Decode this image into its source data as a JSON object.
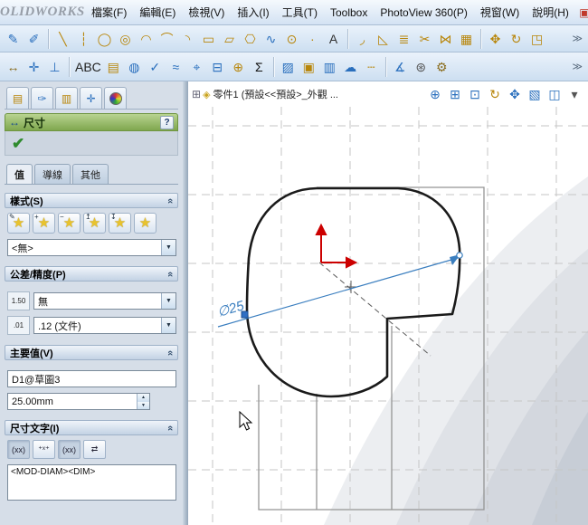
{
  "colors": {
    "accent_blue": "#2a6fbd",
    "toolbar_gold": "#b8860b",
    "panel_header_green": "#7fa74e",
    "dimension_blue": "#3a7ebf",
    "origin_red": "#cc0000",
    "selected_handle_blue": "#2f6fc4"
  },
  "titlebar": {
    "logo_text": "OLIDWORKS",
    "menus": [
      "檔案(F)",
      "編輯(E)",
      "檢視(V)",
      "插入(I)",
      "工具(T)",
      "Toolbox",
      "PhotoView 360(P)",
      "視窗(W)",
      "說明(H)"
    ],
    "resources_icon": "▣"
  },
  "toolbar1": {
    "overflow": "≫",
    "g1": [
      {
        "name": "sketch-icon",
        "glyph": "✎",
        "color": "#2a6fbd"
      },
      {
        "name": "3d-sketch-icon",
        "glyph": "✐",
        "color": "#2a6fbd"
      }
    ],
    "g2": [
      {
        "name": "line-tool-icon",
        "glyph": "╲",
        "color": "#b8860b"
      },
      {
        "name": "centerline-tool-icon",
        "glyph": "┆",
        "color": "#b8860b"
      },
      {
        "name": "circle-tool-icon",
        "glyph": "◯",
        "color": "#b8860b"
      },
      {
        "name": "perimeter-circle-tool-icon",
        "glyph": "◎",
        "color": "#b8860b"
      },
      {
        "name": "centerpoint-arc-tool-icon",
        "glyph": "◠",
        "color": "#b8860b"
      },
      {
        "name": "tangent-arc-tool-icon",
        "glyph": "⌒",
        "color": "#b8860b"
      },
      {
        "name": "three-point-arc-tool-icon",
        "glyph": "◝",
        "color": "#b8860b"
      },
      {
        "name": "rectangle-tool-icon",
        "glyph": "▭",
        "color": "#b8860b"
      },
      {
        "name": "parallelogram-tool-icon",
        "glyph": "▱",
        "color": "#b8860b"
      },
      {
        "name": "polygon-tool-icon",
        "glyph": "⎔",
        "color": "#b8860b"
      },
      {
        "name": "spline-tool-icon",
        "glyph": "∿",
        "color": "#2a6fbd"
      },
      {
        "name": "ellipse-tool-icon",
        "glyph": "⊙",
        "color": "#b8860b"
      },
      {
        "name": "point-tool-icon",
        "glyph": "∙",
        "color": "#b8860b"
      },
      {
        "name": "sketch-text-tool-icon",
        "glyph": "A",
        "color": "#333333"
      }
    ],
    "g3": [
      {
        "name": "sketch-fillet-tool-icon",
        "glyph": "◞",
        "color": "#b8860b"
      },
      {
        "name": "sketch-chamfer-tool-icon",
        "glyph": "◺",
        "color": "#b8860b"
      },
      {
        "name": "offset-entities-tool-icon",
        "glyph": "≣",
        "color": "#b8860b"
      },
      {
        "name": "trim-entities-tool-icon",
        "glyph": "✂",
        "color": "#b8860b"
      },
      {
        "name": "mirror-entities-tool-icon",
        "glyph": "⋈",
        "color": "#b8860b"
      },
      {
        "name": "sketch-pattern-tool-icon",
        "glyph": "▦",
        "color": "#b8860b"
      }
    ],
    "g4": [
      {
        "name": "move-entities-tool-icon",
        "glyph": "✥",
        "color": "#b8860b"
      },
      {
        "name": "rotate-entities-tool-icon",
        "glyph": "↻",
        "color": "#b8860b"
      },
      {
        "name": "scale-entities-tool-icon",
        "glyph": "◳",
        "color": "#b8860b"
      }
    ]
  },
  "toolbar2": {
    "overflow": "≫",
    "g1": [
      {
        "name": "smart-dimension-icon",
        "glyph": "↔",
        "color": "#8a6d1f"
      },
      {
        "name": "model-items-icon",
        "glyph": "✛",
        "color": "#2a6fbd"
      },
      {
        "name": "add-relation-icon",
        "glyph": "⊥",
        "color": "#2a6fbd"
      }
    ],
    "g2": [
      {
        "name": "spell-checker-icon",
        "glyph": "ABC",
        "color": "#222222"
      },
      {
        "name": "note-icon",
        "glyph": "▤",
        "color": "#b8860b"
      },
      {
        "name": "balloon-icon",
        "glyph": "◍",
        "color": "#2a6fbd"
      },
      {
        "name": "surface-finish-icon",
        "glyph": "✓",
        "color": "#2a6fbd"
      },
      {
        "name": "weld-symbol-icon",
        "glyph": "≈",
        "color": "#2a6fbd"
      },
      {
        "name": "geometric-tolerance-icon",
        "glyph": "⌖",
        "color": "#2a6fbd"
      },
      {
        "name": "datum-feature-icon",
        "glyph": "⊟",
        "color": "#2a6fbd"
      },
      {
        "name": "center-mark-icon",
        "glyph": "⊕",
        "color": "#b8860b"
      },
      {
        "name": "equations-icon",
        "glyph": "Σ",
        "color": "#111111"
      }
    ],
    "g3": [
      {
        "name": "area-hatch-icon",
        "glyph": "▨",
        "color": "#2a6fbd"
      },
      {
        "name": "blocks-icon",
        "glyph": "▣",
        "color": "#b8860b"
      },
      {
        "name": "tables-icon",
        "glyph": "▥",
        "color": "#2a6fbd"
      },
      {
        "name": "revision-cloud-icon",
        "glyph": "☁",
        "color": "#2a6fbd"
      },
      {
        "name": "centerline-annotation-icon",
        "glyph": "┄",
        "color": "#b8860b"
      }
    ],
    "g4": [
      {
        "name": "measure-icon",
        "glyph": "∡",
        "color": "#2a6fbd"
      },
      {
        "name": "mass-properties-icon",
        "glyph": "⊛",
        "color": "#555555"
      },
      {
        "name": "options-icon",
        "glyph": "⚙",
        "color": "#8a6d1f"
      }
    ]
  },
  "property_panel": {
    "pm_tabs": [
      {
        "name": "featuremanager-tab-icon",
        "glyph": "▤",
        "color": "#b8860b"
      },
      {
        "name": "propertymanager-tab-icon",
        "glyph": "✑",
        "color": "#2a6fbd"
      },
      {
        "name": "configurationmanager-tab-icon",
        "glyph": "▥",
        "color": "#b8860b"
      },
      {
        "name": "dimxpertmanager-tab-icon",
        "glyph": "✛",
        "color": "#2a6fbd"
      }
    ],
    "header": {
      "icon": "↔",
      "title": "尺寸",
      "help": "?"
    },
    "confirm": {
      "ok": "✔"
    },
    "tabs": {
      "value": "值",
      "leaders": "導線",
      "other": "其他"
    },
    "sections": {
      "style": {
        "title": "樣式(S)",
        "chevron": "«",
        "buttons": [
          {
            "name": "apply-default-style-button",
            "glyph": "★",
            "badge": "✎"
          },
          {
            "name": "add-style-button",
            "glyph": "★",
            "badge": "+"
          },
          {
            "name": "delete-style-button",
            "glyph": "★",
            "badge": "−"
          },
          {
            "name": "save-style-button",
            "glyph": "★",
            "badge": "↥"
          },
          {
            "name": "load-style-button",
            "glyph": "★",
            "badge": "↧"
          },
          {
            "name": "style-favorite-button",
            "glyph": "★",
            "badge": ""
          }
        ],
        "dropdown_value": "<無>"
      },
      "tolerance": {
        "title": "公差/精度(P)",
        "chevron": "«",
        "rows": [
          {
            "icon_label": "1.50",
            "value": "無"
          },
          {
            "icon_label": ".01",
            "value": ".12 (文件)"
          }
        ]
      },
      "primary_value": {
        "title": "主要值(V)",
        "chevron": "«",
        "name_value": "D1@草圖3",
        "dim_value": "25.00mm"
      },
      "dimension_text": {
        "title": "尺寸文字(I)",
        "chevron": "«",
        "buttons": [
          {
            "label": "(xx)",
            "name": "dimension-text-center-button"
          },
          {
            "label": "⁺ˣ⁺",
            "name": "dimension-text-offset-button"
          },
          {
            "label": "(xx)",
            "name": "dimension-text-solid-button"
          },
          {
            "label": "⇄",
            "name": "flip-arrows-button"
          }
        ],
        "text": "<MOD-DIAM><DIM>"
      }
    }
  },
  "viewport": {
    "tree_expand_icon": "⊞",
    "part_icon": "◈",
    "doc_tab_label": "零件1 (預設<<預設>_外觀 ...",
    "dimension_label": "∅25",
    "view_tools": [
      {
        "name": "zoom-in-out-icon",
        "glyph": "⊕",
        "color": "#2a6fbd"
      },
      {
        "name": "zoom-to-fit-icon",
        "glyph": "⊞",
        "color": "#2a6fbd"
      },
      {
        "name": "zoom-to-area-icon",
        "glyph": "⊡",
        "color": "#2a6fbd"
      },
      {
        "name": "rotate-view-icon",
        "glyph": "↻",
        "color": "#b8860b"
      },
      {
        "name": "pan-icon",
        "glyph": "✥",
        "color": "#2a6fbd"
      },
      {
        "name": "view-orientation-icon",
        "glyph": "▧",
        "color": "#2a6fbd"
      },
      {
        "name": "section-view-icon",
        "glyph": "◫",
        "color": "#2a6fbd"
      },
      {
        "name": "view-settings-icon",
        "glyph": "▾",
        "color": "#555555"
      }
    ]
  }
}
